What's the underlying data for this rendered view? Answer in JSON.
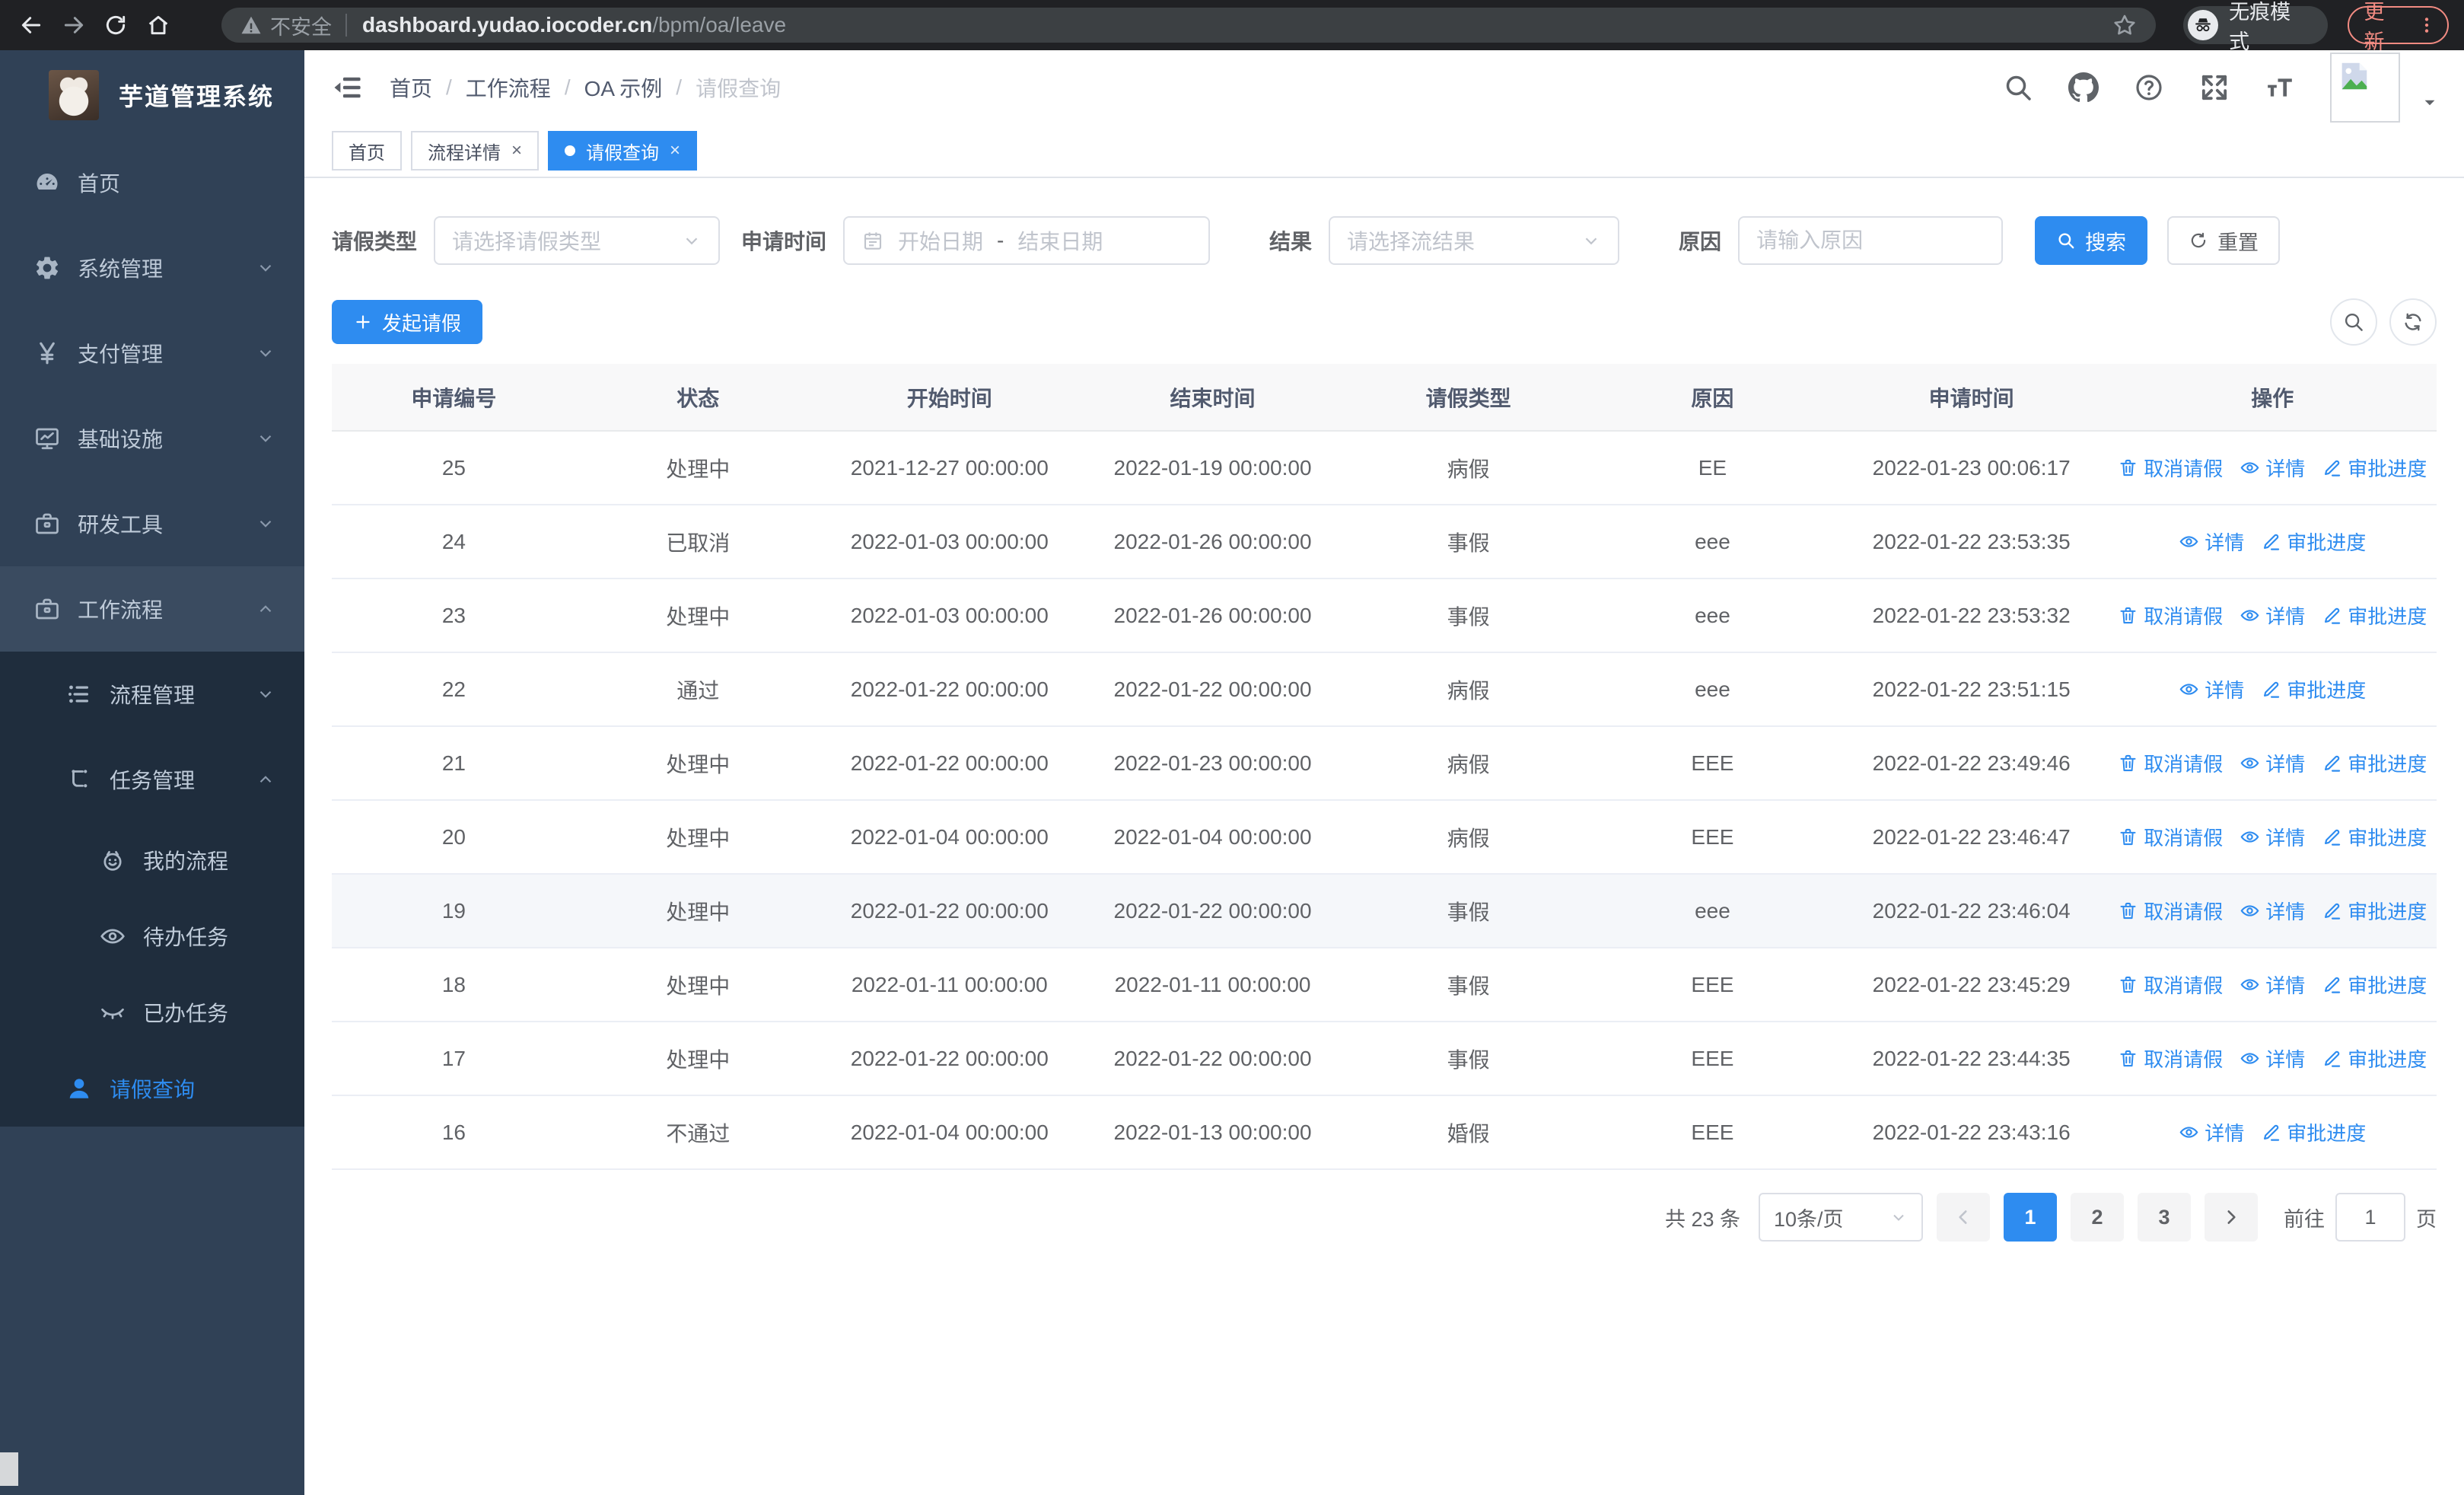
{
  "colors": {
    "accent": "#2e8cf0",
    "sidebar_bg": "#304156",
    "sidebar_sub_bg": "#1f2d3d",
    "link": "#2e8cf0"
  },
  "browser": {
    "security_label": "不安全",
    "url_host": "dashboard.yudao.iocoder.cn",
    "url_path": "/bpm/oa/leave",
    "incognito_label": "无痕模式",
    "update_label": "更新"
  },
  "sidebar": {
    "title": "芋道管理系统",
    "items": [
      {
        "name": "home",
        "label": "首页",
        "icon": "gauge",
        "level": 1
      },
      {
        "name": "system",
        "label": "系统管理",
        "icon": "gear",
        "level": 1,
        "chevron": "down"
      },
      {
        "name": "payment",
        "label": "支付管理",
        "icon": "yen",
        "level": 1,
        "chevron": "down"
      },
      {
        "name": "infra",
        "label": "基础设施",
        "icon": "monitor",
        "level": 1,
        "chevron": "down"
      },
      {
        "name": "devtools",
        "label": "研发工具",
        "icon": "briefcase",
        "level": 1,
        "chevron": "down"
      },
      {
        "name": "workflow",
        "label": "工作流程",
        "icon": "briefcase",
        "level": 1,
        "chevron": "up",
        "open": true
      },
      {
        "name": "process-mgmt",
        "label": "流程管理",
        "icon": "list",
        "level": 2,
        "chevron": "down",
        "sub": true
      },
      {
        "name": "task-mgmt",
        "label": "任务管理",
        "icon": "flow",
        "level": 2,
        "chevron": "up",
        "sub": true
      },
      {
        "name": "my-process",
        "label": "我的流程",
        "icon": "face",
        "level": 3,
        "sub": true,
        "small": true
      },
      {
        "name": "todo-tasks",
        "label": "待办任务",
        "icon": "eye",
        "level": 3,
        "sub": true,
        "small": true
      },
      {
        "name": "done-tasks",
        "label": "已办任务",
        "icon": "eye-closed",
        "level": 3,
        "sub": true,
        "small": true
      },
      {
        "name": "leave-query",
        "label": "请假查询",
        "icon": "user",
        "level": 2,
        "sub": true,
        "small": true,
        "active": true
      }
    ]
  },
  "header": {
    "breadcrumb": [
      {
        "label": "首页"
      },
      {
        "label": "工作流程"
      },
      {
        "label": "OA 示例"
      },
      {
        "label": "请假查询",
        "current": true
      }
    ]
  },
  "tabs": [
    {
      "name": "home",
      "label": "首页"
    },
    {
      "name": "process-detail",
      "label": "流程详情",
      "closable": true
    },
    {
      "name": "leave-query",
      "label": "请假查询",
      "closable": true,
      "active": true
    }
  ],
  "filters": {
    "leave_type": {
      "label": "请假类型",
      "placeholder": "请选择请假类型"
    },
    "apply_time": {
      "label": "申请时间",
      "start_placeholder": "开始日期",
      "separator": "-",
      "end_placeholder": "结束日期"
    },
    "result": {
      "label": "结果",
      "placeholder": "请选择流结果"
    },
    "reason": {
      "label": "原因",
      "placeholder": "请输入原因"
    },
    "search_label": "搜索",
    "reset_label": "重置"
  },
  "toolbar": {
    "create_label": "发起请假"
  },
  "table": {
    "columns": [
      "申请编号",
      "状态",
      "开始时间",
      "结束时间",
      "请假类型",
      "原因",
      "申请时间",
      "操作"
    ],
    "action_labels": {
      "cancel": "取消请假",
      "detail": "详情",
      "progress": "审批进度"
    },
    "rows": [
      {
        "id": "25",
        "status": "处理中",
        "start": "2021-12-27 00:00:00",
        "end": "2022-01-19 00:00:00",
        "type": "病假",
        "reason": "EE",
        "applied": "2022-01-23 00:06:17",
        "actions": [
          "cancel",
          "detail",
          "progress"
        ]
      },
      {
        "id": "24",
        "status": "已取消",
        "start": "2022-01-03 00:00:00",
        "end": "2022-01-26 00:00:00",
        "type": "事假",
        "reason": "eee",
        "applied": "2022-01-22 23:53:35",
        "actions": [
          "detail",
          "progress"
        ]
      },
      {
        "id": "23",
        "status": "处理中",
        "start": "2022-01-03 00:00:00",
        "end": "2022-01-26 00:00:00",
        "type": "事假",
        "reason": "eee",
        "applied": "2022-01-22 23:53:32",
        "actions": [
          "cancel",
          "detail",
          "progress"
        ]
      },
      {
        "id": "22",
        "status": "通过",
        "start": "2022-01-22 00:00:00",
        "end": "2022-01-22 00:00:00",
        "type": "病假",
        "reason": "eee",
        "applied": "2022-01-22 23:51:15",
        "actions": [
          "detail",
          "progress"
        ]
      },
      {
        "id": "21",
        "status": "处理中",
        "start": "2022-01-22 00:00:00",
        "end": "2022-01-23 00:00:00",
        "type": "病假",
        "reason": "EEE",
        "applied": "2022-01-22 23:49:46",
        "actions": [
          "cancel",
          "detail",
          "progress"
        ]
      },
      {
        "id": "20",
        "status": "处理中",
        "start": "2022-01-04 00:00:00",
        "end": "2022-01-04 00:00:00",
        "type": "病假",
        "reason": "EEE",
        "applied": "2022-01-22 23:46:47",
        "actions": [
          "cancel",
          "detail",
          "progress"
        ]
      },
      {
        "id": "19",
        "status": "处理中",
        "start": "2022-01-22 00:00:00",
        "end": "2022-01-22 00:00:00",
        "type": "事假",
        "reason": "eee",
        "applied": "2022-01-22 23:46:04",
        "actions": [
          "cancel",
          "detail",
          "progress"
        ],
        "highlight": true
      },
      {
        "id": "18",
        "status": "处理中",
        "start": "2022-01-11 00:00:00",
        "end": "2022-01-11 00:00:00",
        "type": "事假",
        "reason": "EEE",
        "applied": "2022-01-22 23:45:29",
        "actions": [
          "cancel",
          "detail",
          "progress"
        ]
      },
      {
        "id": "17",
        "status": "处理中",
        "start": "2022-01-22 00:00:00",
        "end": "2022-01-22 00:00:00",
        "type": "事假",
        "reason": "EEE",
        "applied": "2022-01-22 23:44:35",
        "actions": [
          "cancel",
          "detail",
          "progress"
        ]
      },
      {
        "id": "16",
        "status": "不通过",
        "start": "2022-01-04 00:00:00",
        "end": "2022-01-13 00:00:00",
        "type": "婚假",
        "reason": "EEE",
        "applied": "2022-01-22 23:43:16",
        "actions": [
          "detail",
          "progress"
        ]
      }
    ]
  },
  "pagination": {
    "total_label": "共 23 条",
    "page_size": "10条/页",
    "pages": [
      "1",
      "2",
      "3"
    ],
    "active_page": "1",
    "goto_label": "前往",
    "goto_value": "1",
    "unit_label": "页"
  }
}
